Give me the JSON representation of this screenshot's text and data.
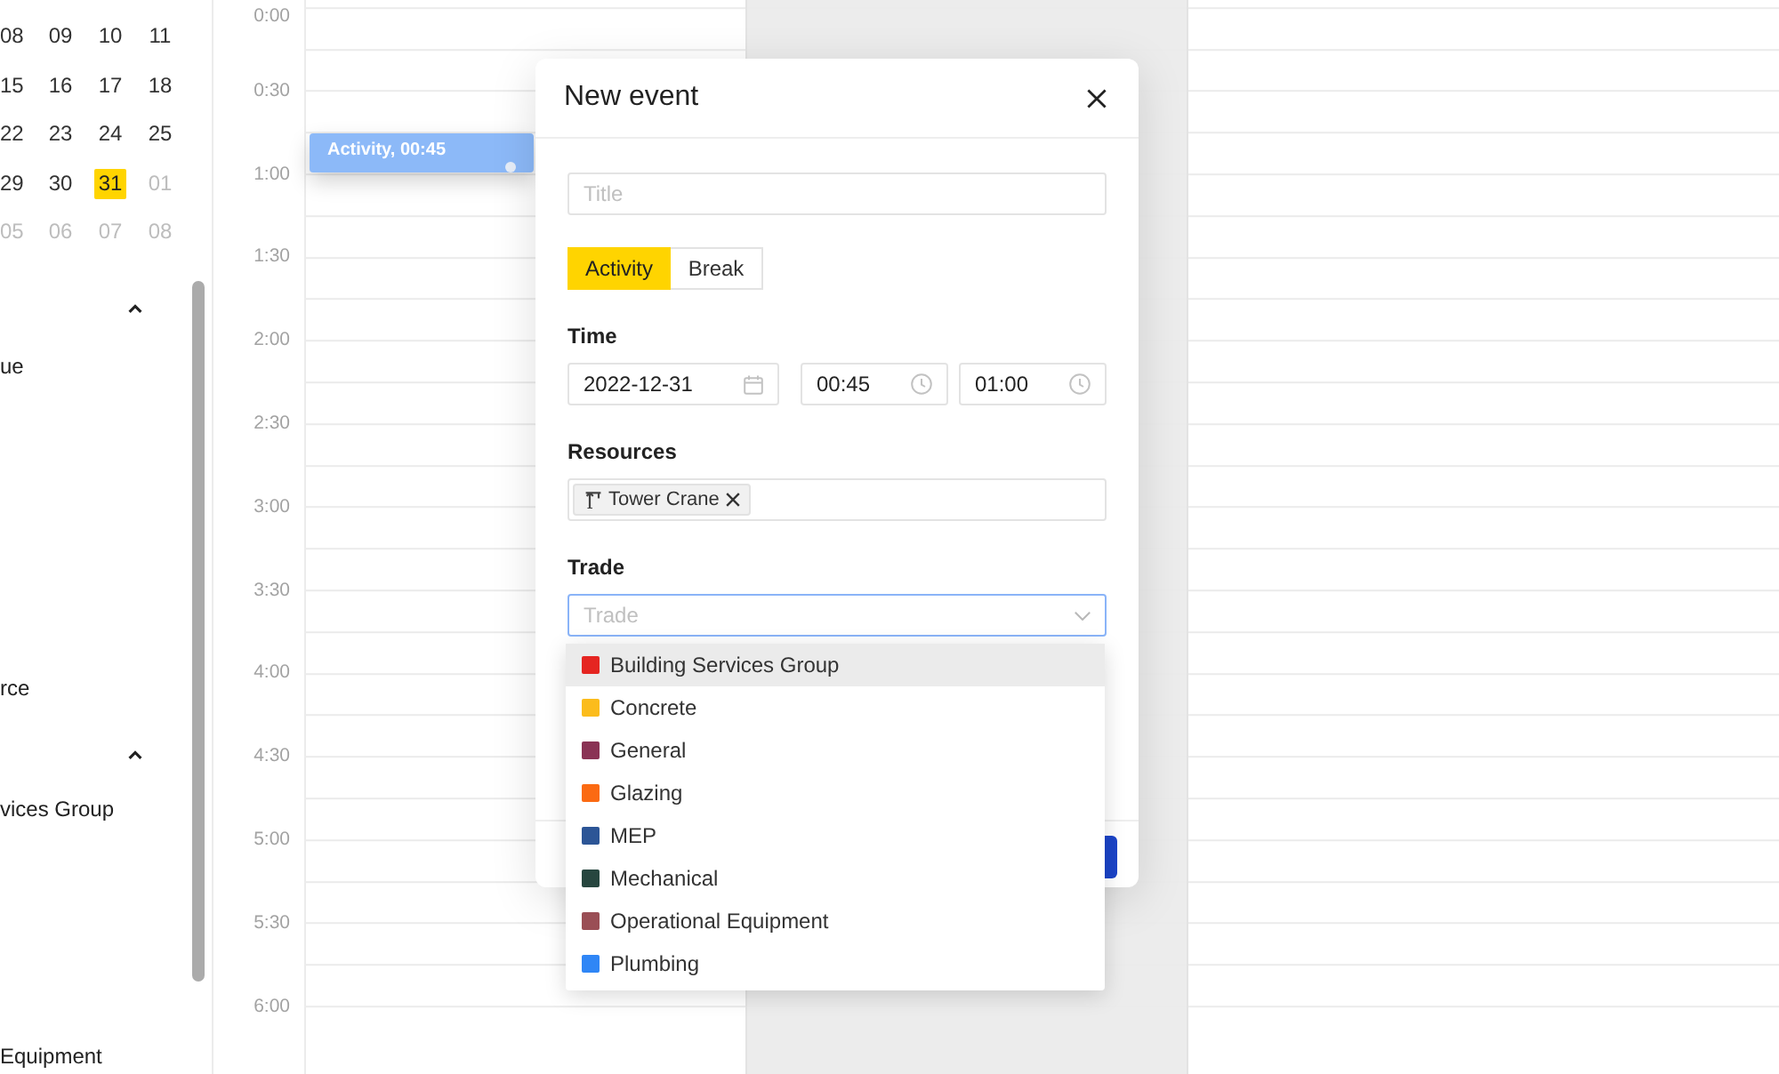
{
  "sidebar": {
    "mini_calendar": {
      "weeks": [
        [
          {
            "day": "08",
            "outside_month": false,
            "selected": false
          },
          {
            "day": "09",
            "outside_month": false,
            "selected": false
          },
          {
            "day": "10",
            "outside_month": false,
            "selected": false
          },
          {
            "day": "11",
            "outside_month": false,
            "selected": false
          }
        ],
        [
          {
            "day": "15",
            "outside_month": false,
            "selected": false
          },
          {
            "day": "16",
            "outside_month": false,
            "selected": false
          },
          {
            "day": "17",
            "outside_month": false,
            "selected": false
          },
          {
            "day": "18",
            "outside_month": false,
            "selected": false
          }
        ],
        [
          {
            "day": "22",
            "outside_month": false,
            "selected": false
          },
          {
            "day": "23",
            "outside_month": false,
            "selected": false
          },
          {
            "day": "24",
            "outside_month": false,
            "selected": false
          },
          {
            "day": "25",
            "outside_month": false,
            "selected": false
          }
        ],
        [
          {
            "day": "29",
            "outside_month": false,
            "selected": false
          },
          {
            "day": "30",
            "outside_month": false,
            "selected": false
          },
          {
            "day": "31",
            "outside_month": false,
            "selected": true
          },
          {
            "day": "01",
            "outside_month": true,
            "selected": false
          }
        ],
        [
          {
            "day": "05",
            "outside_month": true,
            "selected": false
          },
          {
            "day": "06",
            "outside_month": true,
            "selected": false
          },
          {
            "day": "07",
            "outside_month": true,
            "selected": false
          },
          {
            "day": "08",
            "outside_month": true,
            "selected": false
          }
        ]
      ]
    },
    "groups": [
      {
        "expanded": true,
        "items": [
          {
            "label": "ue"
          },
          {
            "label": "rce"
          }
        ]
      },
      {
        "expanded": true,
        "items": [
          {
            "label": "vices Group"
          },
          {
            "label": "Equipment"
          }
        ]
      }
    ]
  },
  "calendar": {
    "time_labels": [
      "0:00",
      "0:30",
      "1:00",
      "1:30",
      "2:00",
      "2:30",
      "3:00",
      "3:30",
      "4:00",
      "4:30",
      "5:00",
      "5:30",
      "6:00"
    ],
    "day_columns": [
      {
        "shaded": false,
        "events": [
          {
            "label": "Activity, 00:45"
          }
        ]
      },
      {
        "shaded": true
      },
      {
        "shaded": false
      }
    ]
  },
  "dialog": {
    "title": "New event",
    "title_field": {
      "placeholder": "Title"
    },
    "event_type": [
      {
        "label": "Activity",
        "selected": true
      },
      {
        "label": "Break",
        "selected": false
      }
    ],
    "time": {
      "label": "Time",
      "fields": [
        {
          "kind": "date",
          "value": "2022-12-31"
        },
        {
          "kind": "time",
          "value": "00:45"
        },
        {
          "kind": "time",
          "value": "01:00"
        }
      ]
    },
    "resources": {
      "label": "Resources",
      "chips": [
        {
          "label": "Tower Crane"
        }
      ]
    },
    "trade": {
      "label": "Trade",
      "placeholder": "Trade",
      "focused": true,
      "options": [
        {
          "label": "Building Services Group",
          "color": "#e52521",
          "highlighted": true
        },
        {
          "label": "Concrete",
          "color": "#fbbc1c",
          "highlighted": false
        },
        {
          "label": "General",
          "color": "#8a3355",
          "highlighted": false
        },
        {
          "label": "Glazing",
          "color": "#fb6a12",
          "highlighted": false
        },
        {
          "label": "MEP",
          "color": "#2c5596",
          "highlighted": false
        },
        {
          "label": "Mechanical",
          "color": "#27463f",
          "highlighted": false
        },
        {
          "label": "Operational Equipment",
          "color": "#9a4e55",
          "highlighted": false
        },
        {
          "label": "Plumbing",
          "color": "#2f86f6",
          "highlighted": false
        }
      ]
    }
  }
}
